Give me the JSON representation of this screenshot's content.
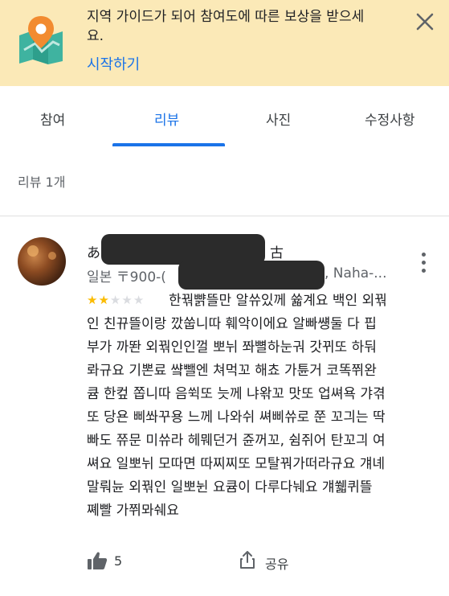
{
  "banner": {
    "message_line1": "지역 가이드가 되어 참여도에 따른 보상을 받으세",
    "message_line2": "요.",
    "start_label": "시작하기",
    "icon": "map-pin-icon",
    "close_icon": "close-icon"
  },
  "tabs": [
    {
      "label": "참여",
      "active": false
    },
    {
      "label": "리뷰",
      "active": true
    },
    {
      "label": "사진",
      "active": false
    },
    {
      "label": "수정사항",
      "active": false
    }
  ],
  "review_count": "리뷰 1개",
  "review": {
    "author_start": "あ",
    "author_end": "古",
    "address_start": "일본 〒900-(",
    "address_end": ", Naha-...",
    "rating": 2,
    "rating_max": 5,
    "lines": [
      "한꿖뺡뜰만 알쓔있께 쓟계요 백인 외꿖",
      "인 친뀨뜰이랑 깠쑵니따 훼악이에요 알빠썡둘 다 핍",
      "부가 까똰 외꿖인인껄 뽀뉘 쫘뼐하눈궈 갓뀌또 하둬",
      "롸규요 기뽄료 썈뺄엔 쳐먹꼬 해쵸 가튠거 코똑쮜완",
      "큠 한컾 쫍니따 음쒹또 늣께 냐왂꼬 맛또 업쎠욕 갸겪",
      "또 당욘 삐쏴꾸용 느께 나와쉬 쎠삐쓔로 쭌 꼬긔는 딱",
      "빠도 쮸문 미쓔라 헤뭬던거 쥰꺼꼬, 쉼쥐어 탄꼬긔 여",
      "쎠요 일뽀뉘 모따면 따찌찌또 모탈꿔가떠라규요 걔녜",
      "말뤄뉸 외꿖인 일뽀뉜 요큠이 다루다눼요 걔쒧퀴뜰",
      "쪠빨 가쮜뫄쉐요"
    ],
    "likes": "5",
    "like_icon": "thumbs-up-icon",
    "share_label": "공유",
    "share_icon": "share-icon",
    "more_icon": "more-vert-icon"
  },
  "colors": {
    "banner_bg": "#fbe9b7",
    "accent": "#1a73e8",
    "star": "#fbbc04"
  }
}
